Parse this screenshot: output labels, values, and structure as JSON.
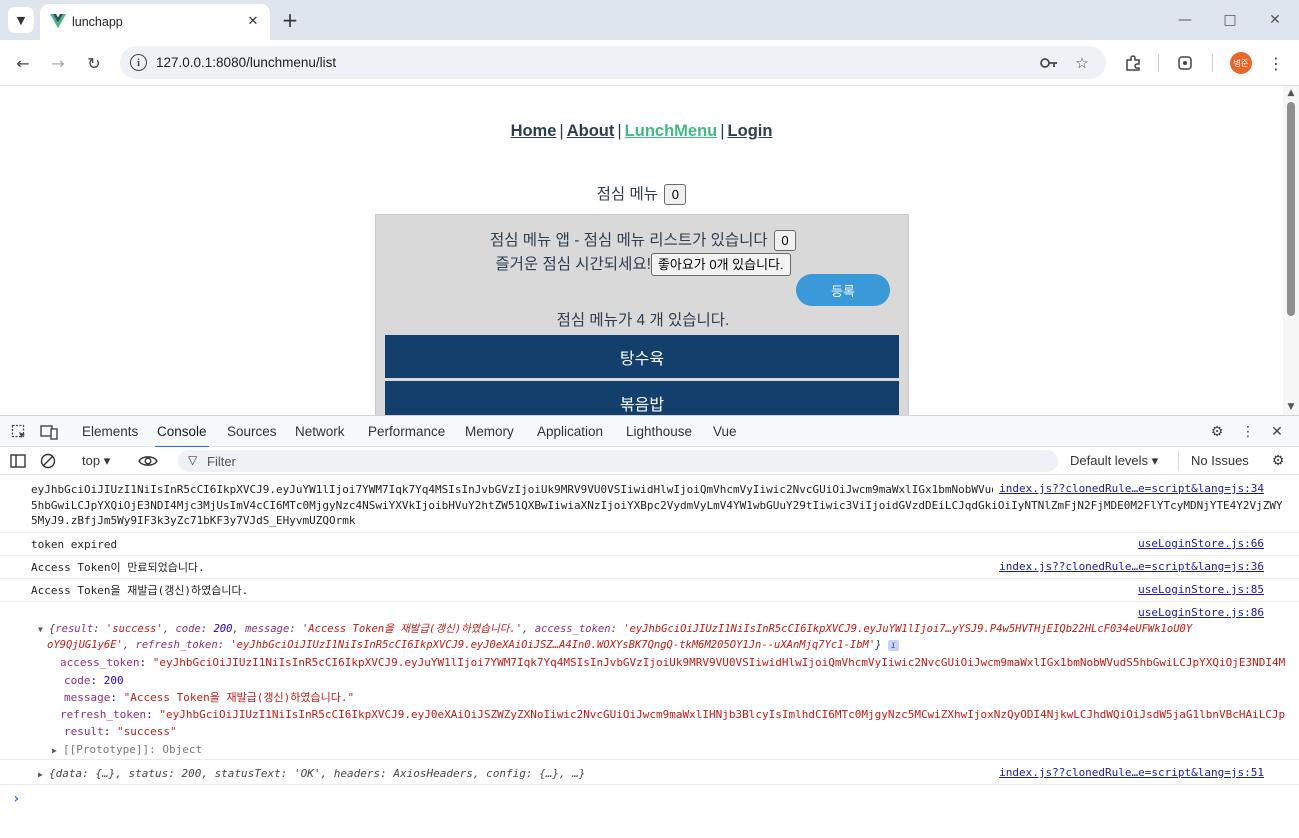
{
  "browser": {
    "tab_title": "lunchapp",
    "url": "127.0.0.1:8080/lunchmenu/list",
    "avatar_text": "병준"
  },
  "page": {
    "nav": [
      "Home",
      "About",
      "LunchMenu",
      "Login"
    ],
    "nav_separator": "|",
    "lunch_title": "점심 메뉴",
    "title_count": "0",
    "panel_line1": "점심 메뉴 앱 - 점심 메뉴 리스트가 있습니다",
    "panel_line1_count": "0",
    "panel_line2": "즐거운 점심 시간되세요!",
    "like_button": "좋아요가 0개 있습니다.",
    "register_button": "등록",
    "menu_count_text": "점심 메뉴가 4 개 있습니다.",
    "menu_items": [
      "탕수육",
      "볶음밥"
    ]
  },
  "devtools": {
    "tabs": [
      "Elements",
      "Console",
      "Sources",
      "Network",
      "Performance",
      "Memory",
      "Application",
      "Lighthouse",
      "Vue"
    ],
    "active_tab": "Console",
    "context": "top",
    "filter_placeholder": "Filter",
    "levels": "Default levels",
    "issues": "No Issues",
    "messages": [
      {
        "lines": [
          "eyJhbGciOiJIUzI1NiIsInR5cCI6IkpXVCJ9.eyJuYW1lIjoi7YWM7Iqk7Yq4MSIsInJvbGVzIjoiUk9MRV9VU0VSIiwidHlwIjoiQmVhcmVyIiwic2NvcGUiOiJwcm9maWxlIGx1bmNobWVudS",
          "5hbGwiLCJpYXQiOjE3NDI4Mjc3MjUsImV4cCI6MTc0MjgyNzc4NSwiYXVkIjoibHVuY2htZW51QXBwIiwiaXNzIjoiYXBpc2VydmVyLmV4YW1wbGUuY29tIiwic3ViIjoidGVzdDEiLCJqdGkiOiIyNTNlZmFjN2FjMDE0M2FlYTcyMDNjYTE4Y2VjZWY",
          "5MyJ9.zBfjJm5Wy9IF3k3yZc71bKF3y7VJdS_EHyvmUZQOrmk"
        ],
        "source": "index.js??clonedRule…e=script&lang=js:34"
      },
      {
        "text": "token expired",
        "source": "useLoginStore.js:66"
      },
      {
        "text": "Access Token이 만료되었습니다.",
        "source": "index.js??clonedRule…e=script&lang=js:36"
      },
      {
        "text": "Access Token을 재발급(갱신)하였습니다.",
        "source": "useLoginStore.js:85"
      }
    ],
    "object_log": {
      "source": "useLoginStore.js:86",
      "summary": {
        "result": "'success'",
        "code": "200",
        "message": "'Access Token을 재발급(갱신)하였습니다.'",
        "access_token": "'eyJhbGciOiJIUzI1NiIsInR5cCI6IkpXVCJ9.eyJuYW1lIjoi7…yYSJ9.P4w5HVTHjEIQb22HLcF034eUFWk1oU0Y",
        "access_token_cont": "oY9QjUG1y6E'",
        "refresh_token": "'eyJhbGciOiJIUzI1NiIsInR5cCI6IkpXVCJ9.eyJ0eXAiOiJSZ…A4In0.WOXYsBK7QngQ-tkM6M205OY1Jn--uXAnMjq7Yc1-IbM'"
      },
      "fields": [
        {
          "key": "access_token",
          "value": "\"eyJhbGciOiJIUzI1NiIsInR5cCI6IkpXVCJ9.eyJuYW1lIjoi7YWM7Iqk7Yq4MSIsInJvbGVzIjoiUk9MRV9VU0VSIiwidHlwIjoiQmVhcmVyIiwic2NvcGUiOiJwcm9maWxlIGx1bmNobWVudS5hbGwiLCJpYXQiOjE3NDI4M"
        },
        {
          "key": "code",
          "value": "200"
        },
        {
          "key": "message",
          "value": "\"Access Token을 재발급(갱신)하였습니다.\""
        },
        {
          "key": "refresh_token",
          "value": "\"eyJhbGciOiJIUzI1NiIsInR5cCI6IkpXVCJ9.eyJ0eXAiOiJSZWZyZXNoIiwic2NvcGUiOiJwcm9maWxlIHNjb3BlcyIsImlhdCI6MTc0MjgyNzc5MCwiZXhwIjoxNzQyODI4NjkwLCJhdWQiOiJsdW5jaG1lbnVBcHAiLCJp"
        },
        {
          "key": "result",
          "value": "\"success\""
        }
      ],
      "prototype": "[[Prototype]]: Object"
    },
    "axios_log": {
      "text": "{data: {…}, status: 200, statusText: 'OK', headers: AxiosHeaders, config: {…}, …}",
      "source": "index.js??clonedRule…e=script&lang=js:51"
    }
  }
}
